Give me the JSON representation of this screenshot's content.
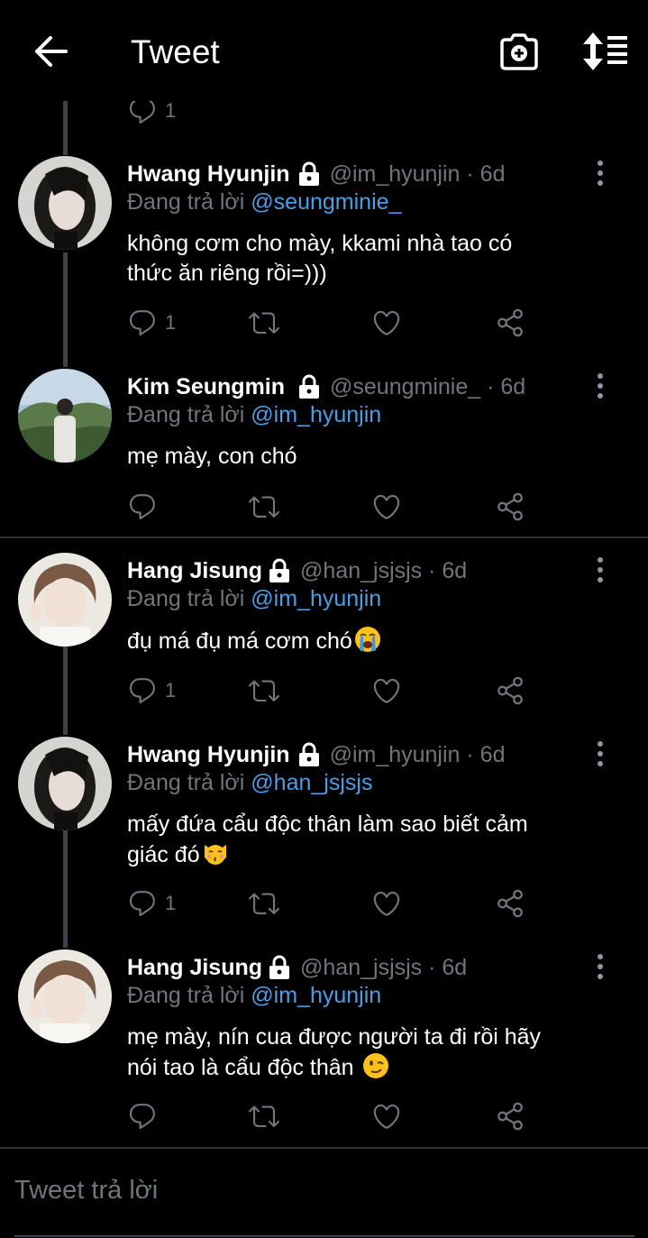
{
  "header": {
    "title": "Tweet"
  },
  "partial_actions": {
    "reply_count": "1"
  },
  "tweets": [
    {
      "name": "Hwang Hyunjin",
      "handle": "@im_hyunjin · 6d",
      "reply_prefix": "Đang trả lời",
      "reply_to": "@seungminie_",
      "text_line1": "không cơm cho mày, kkami nhà tao có",
      "text_line2": "thức ăn riêng rồi=)))",
      "reply_count": "1"
    },
    {
      "name": "Kim Seungmin",
      "handle": "@seungminie_ · 6d",
      "reply_prefix": "Đang trả lời",
      "reply_to": "@im_hyunjin",
      "text_line1": "mẹ mày, con chó",
      "reply_count": ""
    },
    {
      "name": "Hang Jisung",
      "handle": "@han_jsjsjs · 6d",
      "reply_prefix": "Đang trả lời",
      "reply_to": "@im_hyunjin",
      "text_line1": "đụ má đụ má cơm chó",
      "emoji": "loudly-crying-face",
      "reply_count": "1"
    },
    {
      "name": "Hwang Hyunjin",
      "handle": "@im_hyunjin · 6d",
      "reply_prefix": "Đang trả lời",
      "reply_to": "@han_jsjsjs",
      "text_line1": "mấy đứa cẩu độc thân làm sao biết cảm",
      "text_line2": "giác đó",
      "emoji": "kissing-cat-face",
      "reply_count": "1"
    },
    {
      "name": "Hang Jisung",
      "handle": "@han_jsjsjs · 6d",
      "reply_prefix": "Đang trả lời",
      "reply_to": "@im_hyunjin",
      "text_line1": "mẹ mày, nín cua được người ta đi rồi hãy",
      "text_line2": "nói tao là cẩu độc thân",
      "emoji": "winking-face",
      "reply_count": ""
    }
  ],
  "composer": {
    "placeholder": "Tweet trả lời"
  },
  "colors": {
    "background": "#000000",
    "secondary_text": "#71767b",
    "mention": "#4a9ee8",
    "divider": "#2f3336"
  }
}
